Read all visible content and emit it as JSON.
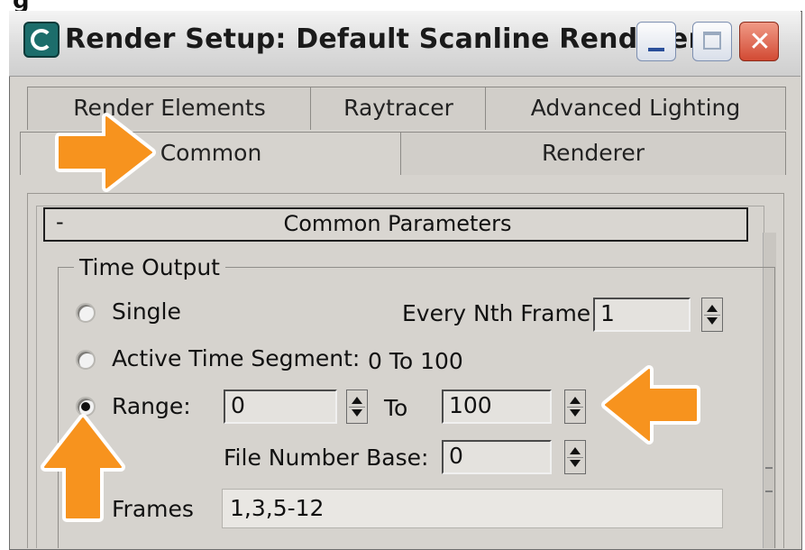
{
  "clipped_caption": "g",
  "window": {
    "title": "Render Setup: Default Scanline Renderer",
    "icon": "3ds-max-app-icon",
    "controls": {
      "minimize": "minimize-icon",
      "maximize": "maximize-icon",
      "close": "close-icon"
    },
    "close_glyph": "✕"
  },
  "tabs": {
    "row1": [
      {
        "label": "Render Elements"
      },
      {
        "label": "Raytracer"
      },
      {
        "label": "Advanced Lighting"
      }
    ],
    "row2": [
      {
        "label": "Common",
        "active": true
      },
      {
        "label": "Renderer"
      }
    ]
  },
  "rollout": {
    "toggle": "-",
    "title": "Common Parameters"
  },
  "time_output": {
    "group_label": "Time Output",
    "options": {
      "single": {
        "label": "Single",
        "selected": false
      },
      "active_segment": {
        "label": "Active Time Segment:",
        "value": "0 To 100",
        "selected": false
      },
      "range": {
        "label": "Range:",
        "selected": true
      }
    },
    "every_nth": {
      "label": "Every Nth Frame:",
      "value": "1"
    },
    "range_from": "0",
    "range_to_label": "To",
    "range_to": "100",
    "file_number_base": {
      "label": "File Number Base:",
      "value": "0"
    },
    "frames": {
      "label": "Frames",
      "value": "1,3,5-12"
    }
  },
  "annotations": {
    "color": "#f7931e",
    "arrows": [
      "arrow-right-icon",
      "arrow-left-icon",
      "arrow-up-icon"
    ]
  }
}
